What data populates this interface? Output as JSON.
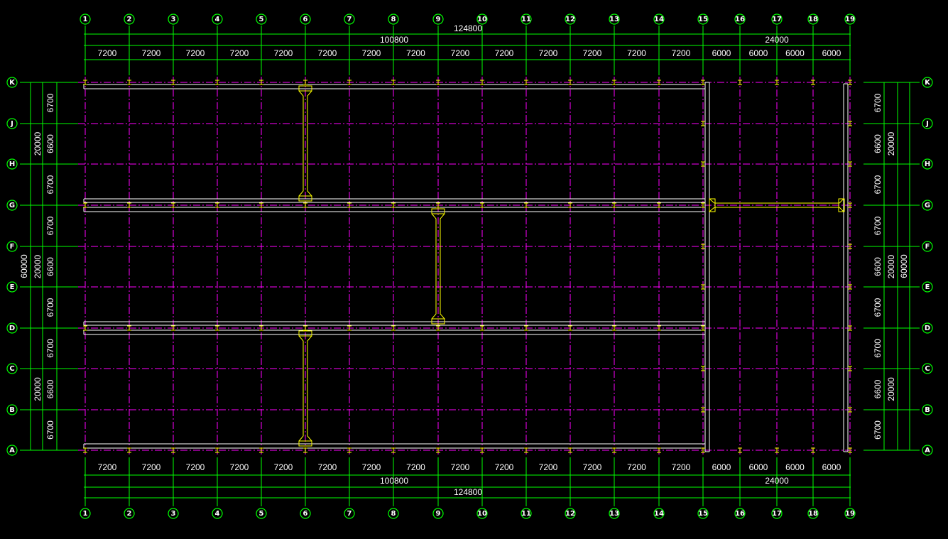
{
  "colors": {
    "background": "#000000",
    "axis_line": "#ff00ff",
    "dimension": "#00ff00",
    "bubble": "#00ff00",
    "beam": "#ffffff",
    "column": "#ffff00",
    "text": "#ffffff"
  },
  "grid": {
    "columns": [
      "1",
      "2",
      "3",
      "4",
      "5",
      "6",
      "7",
      "8",
      "9",
      "10",
      "11",
      "12",
      "13",
      "14",
      "15",
      "16",
      "17",
      "18",
      "19"
    ],
    "rows_top_to_bottom": [
      "K",
      "J",
      "H",
      "G",
      "F",
      "E",
      "D",
      "C",
      "B",
      "A"
    ]
  },
  "dimensions": {
    "total_length": "124800",
    "left_segment_length": "100800",
    "right_segment_length": "24000",
    "bay_spans": [
      "7200",
      "7200",
      "7200",
      "7200",
      "7200",
      "7200",
      "7200",
      "7200",
      "7200",
      "7200",
      "7200",
      "7200",
      "7200",
      "7200",
      "6000",
      "6000",
      "6000",
      "6000"
    ],
    "total_width": "60000",
    "zone_widths_top_to_bottom": [
      "20000",
      "20000",
      "20000"
    ],
    "row_spans_top_to_bottom": [
      "6700",
      "6600",
      "6700",
      "6700",
      "6600",
      "6700",
      "6700",
      "6600",
      "6700"
    ]
  }
}
